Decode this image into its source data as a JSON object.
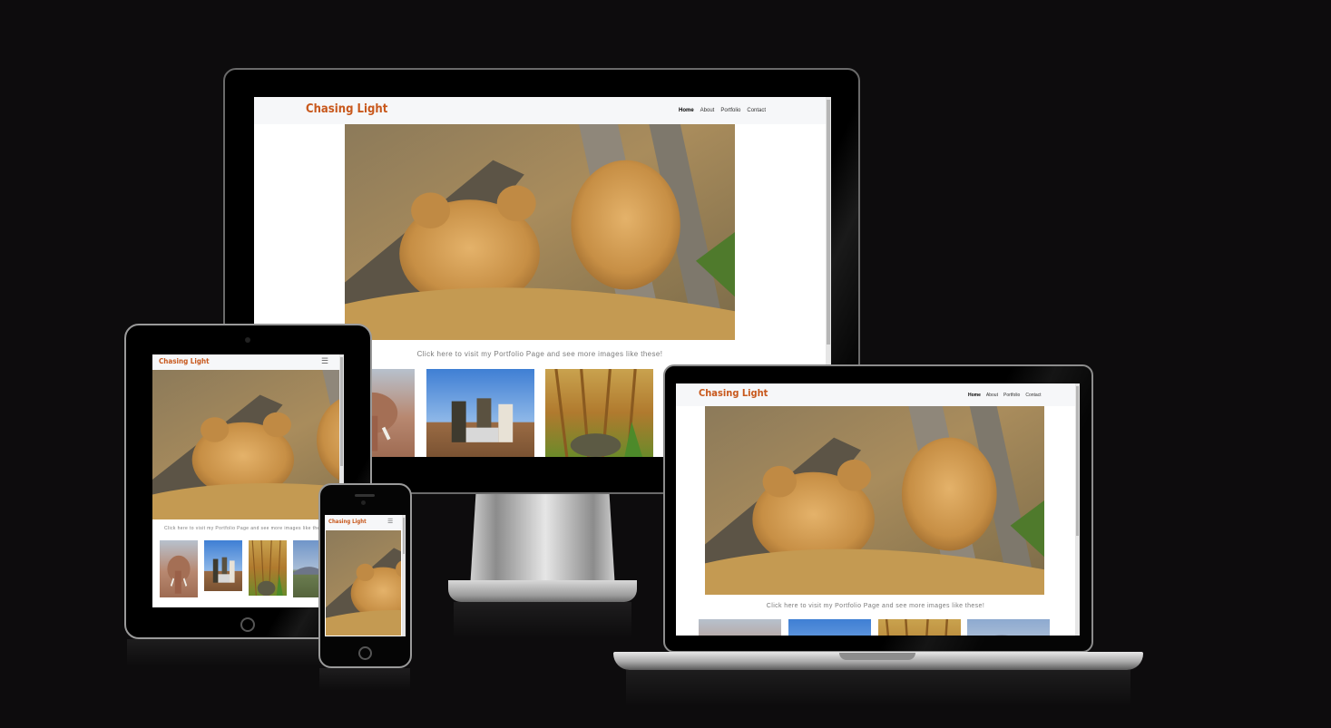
{
  "site": {
    "brand": "Chasing Light",
    "nav": [
      "Home",
      "About",
      "Portfolio",
      "Contact"
    ],
    "cta": "Click here to visit my Portfolio Page and see more images like these!",
    "menu_icon": "hamburger-icon"
  },
  "colors": {
    "background": "#0d0c0d",
    "brand": "#c8581c",
    "nav_background": "#f6f7f9"
  },
  "devices": [
    "desktop",
    "laptop",
    "tablet",
    "phone"
  ],
  "icons": {
    "menu": "hamburger-icon",
    "hero_photo": "lion-cubs-photo",
    "thumbnails": [
      "elephant-photo",
      "people-photo",
      "cheetah-cub-photo",
      "landscape-photo"
    ]
  }
}
